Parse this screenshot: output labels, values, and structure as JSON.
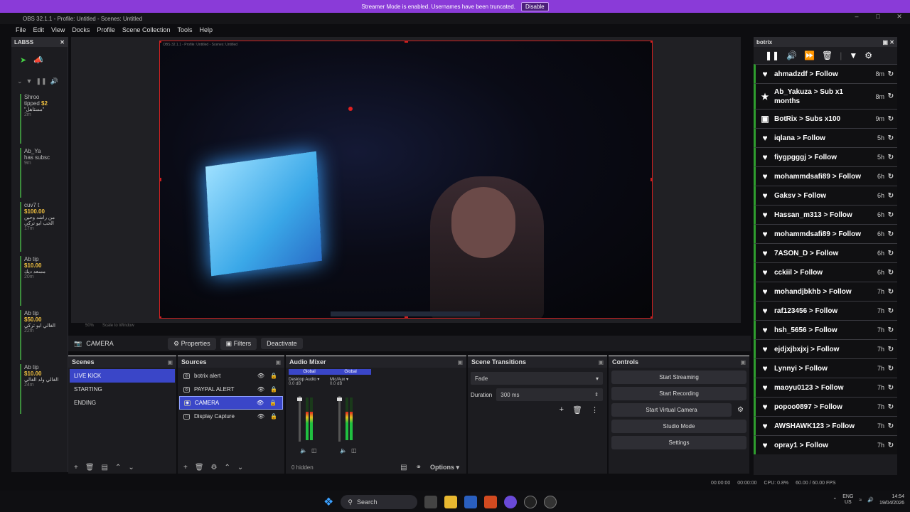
{
  "banner": {
    "text": "Streamer Mode is enabled. Usernames have been truncated.",
    "button": "Disable"
  },
  "window": {
    "title": "OBS 32.1.1 - Profile: Untitled - Scenes: Untitled"
  },
  "menu": [
    "File",
    "Edit",
    "View",
    "Docks",
    "Profile",
    "Scene Collection",
    "Tools",
    "Help"
  ],
  "labss": {
    "title": "LABSS",
    "events": [
      {
        "name": "Shroo",
        "line2": "tipped",
        "amount": "$2",
        "ar": "\"مستاهل\"",
        "time": "2m"
      },
      {
        "name": "Ab_Ya",
        "line2": "has subsc",
        "amount": "",
        "ar": "",
        "time": "9m"
      },
      {
        "name": "cuv7 t",
        "line2": "",
        "amount": "$100.00",
        "ar": "من راشد وحين الحب ابو تركي",
        "time": "17m"
      },
      {
        "name": "Ab tip",
        "line2": "",
        "amount": "$10.00",
        "ar": "مسعد ديك",
        "time": "20m"
      },
      {
        "name": "Ab tip",
        "line2": "",
        "amount": "$50.00",
        "ar": "الغالي ابو تركي",
        "time": "22m"
      },
      {
        "name": "Ab tip",
        "line2": "",
        "amount": "$10.00",
        "ar": "الغالي ولد الغالي",
        "time": "24m"
      }
    ]
  },
  "preview": {
    "mini_title": "OBS 32.1.1 - Profile: Untitled - Scenes: Untitled"
  },
  "canvas_status": {
    "zoom": "50%",
    "scale": "Scale to Window"
  },
  "source_toolbar": {
    "source": "CAMERA",
    "properties": "Properties",
    "filters": "Filters",
    "deactivate": "Deactivate"
  },
  "scenes": {
    "title": "Scenes",
    "items": [
      "LIVE KICK",
      "STARTING",
      "ENDING"
    ],
    "selected": 0
  },
  "sources": {
    "title": "Sources",
    "items": [
      "botrix alert",
      "PAYPAL ALERT",
      "CAMERA",
      "Display Capture"
    ],
    "selected": 2
  },
  "mixer": {
    "title": "Audio Mixer",
    "hidden": "0 hidden",
    "options": "Options",
    "channels": [
      {
        "scope": "Global",
        "name": "Desktop Audio",
        "db": "0.0 dB"
      },
      {
        "scope": "Global",
        "name": "Mic/Aux",
        "db": "0.0 dB"
      }
    ]
  },
  "transitions": {
    "title": "Scene Transitions",
    "type": "Fade",
    "duration_label": "Duration",
    "duration": "300 ms"
  },
  "controls": {
    "title": "Controls",
    "buttons": [
      "Start Streaming",
      "Start Recording",
      "Start Virtual Camera",
      "Studio Mode",
      "Settings"
    ]
  },
  "botrix": {
    "title": "botrix",
    "events": [
      {
        "icon": "heart",
        "text": "ahmadzdf > Follow",
        "time": "8m"
      },
      {
        "icon": "star",
        "text": "Ab_Yakuza > Sub x1 months",
        "time": "8m"
      },
      {
        "icon": "gift",
        "text": "BotRix > Subs x100",
        "time": "9m"
      },
      {
        "icon": "heart",
        "text": "iqlana > Follow",
        "time": "5h"
      },
      {
        "icon": "heart",
        "text": "fiygpgggj > Follow",
        "time": "5h"
      },
      {
        "icon": "heart",
        "text": "mohammdsafi89 > Follow",
        "time": "6h"
      },
      {
        "icon": "heart",
        "text": "Gaksv > Follow",
        "time": "6h"
      },
      {
        "icon": "heart",
        "text": "Hassan_m313 > Follow",
        "time": "6h"
      },
      {
        "icon": "heart",
        "text": "mohammdsafi89 > Follow",
        "time": "6h"
      },
      {
        "icon": "heart",
        "text": "7ASON_D > Follow",
        "time": "6h"
      },
      {
        "icon": "heart",
        "text": "cckiil > Follow",
        "time": "6h"
      },
      {
        "icon": "heart",
        "text": "mohandjbkhb > Follow",
        "time": "7h"
      },
      {
        "icon": "heart",
        "text": "raf123456 > Follow",
        "time": "7h"
      },
      {
        "icon": "heart",
        "text": "hsh_5656 > Follow",
        "time": "7h"
      },
      {
        "icon": "heart",
        "text": "ejdjxjbxjxj > Follow",
        "time": "7h"
      },
      {
        "icon": "heart",
        "text": "Lynnyi > Follow",
        "time": "7h"
      },
      {
        "icon": "heart",
        "text": "maoyu0123 > Follow",
        "time": "7h"
      },
      {
        "icon": "heart",
        "text": "popoo0897 > Follow",
        "time": "7h"
      },
      {
        "icon": "heart",
        "text": "AWSHAWK123 > Follow",
        "time": "7h"
      },
      {
        "icon": "heart",
        "text": "opray1 > Follow",
        "time": "7h"
      }
    ]
  },
  "status": {
    "rec": "00:00:00",
    "stream": "00:00:00",
    "cpu": "CPU: 0.8%",
    "fps": "60.00 / 60.00 FPS"
  },
  "taskbar": {
    "search": "Search",
    "lang": "ENG",
    "region": "US",
    "time": "14:54",
    "date": "19/04/2026"
  }
}
